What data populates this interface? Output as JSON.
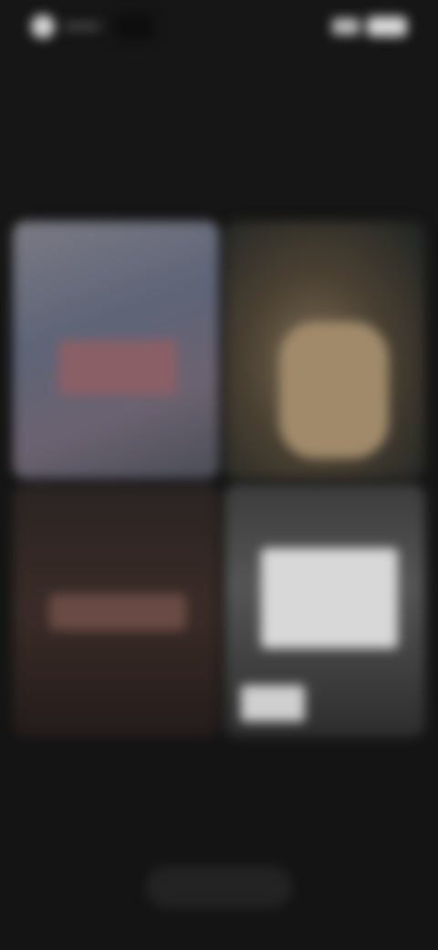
{
  "status_bar": {
    "icons": [
      "app-icon",
      "signal-icon",
      "battery-icon"
    ]
  },
  "header": {
    "title": "",
    "subtitle": ""
  },
  "cards": [
    {
      "name": "media-card-1"
    },
    {
      "name": "media-card-2"
    },
    {
      "name": "media-card-3"
    },
    {
      "name": "media-card-4"
    }
  ],
  "footer": {
    "caption": "",
    "button_label": ""
  },
  "colors": {
    "background": "#151515",
    "title": "#f0f0f0",
    "subtitle": "#8f8f8f"
  }
}
